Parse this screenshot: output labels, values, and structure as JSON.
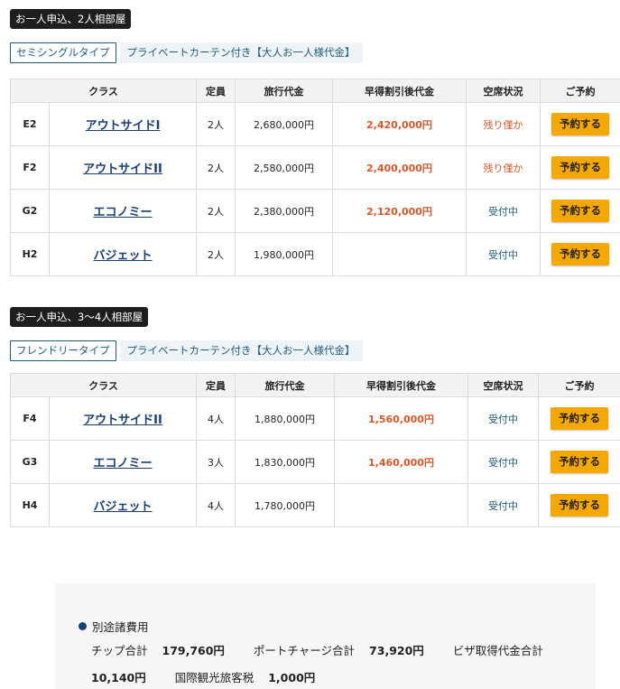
{
  "sections": [
    {
      "tag": "お一人申込、2人相部屋",
      "type_label": "セミシングルタイプ",
      "type_desc": "プライベートカーテン付き【大人お一人様代金】",
      "headers": [
        "クラス",
        "定員",
        "旅行代金",
        "早得割引後代金",
        "空席状況",
        "ご予約"
      ],
      "rows": [
        {
          "code": "E2",
          "class": "アウトサイドI",
          "capacity": "2人",
          "price": "2,680,000円",
          "discount": "2,420,000円",
          "status": "残り僅か",
          "status_type": "few",
          "button": "予約する"
        },
        {
          "code": "F2",
          "class": "アウトサイドII",
          "capacity": "2人",
          "price": "2,580,000円",
          "discount": "2,400,000円",
          "status": "残り僅か",
          "status_type": "few",
          "button": "予約する"
        },
        {
          "code": "G2",
          "class": "エコノミー",
          "capacity": "2人",
          "price": "2,380,000円",
          "discount": "2,120,000円",
          "status": "受付中",
          "status_type": "open",
          "button": "予約する"
        },
        {
          "code": "H2",
          "class": "バジェット",
          "capacity": "2人",
          "price": "1,980,000円",
          "discount": "",
          "status": "受付中",
          "status_type": "open",
          "button": "予約する"
        }
      ]
    },
    {
      "tag": "お一人申込、3〜4人相部屋",
      "type_label": "フレンドリータイプ",
      "type_desc": "プライベートカーテン付き【大人お一人様代金】",
      "headers": [
        "クラス",
        "定員",
        "旅行代金",
        "早得割引後代金",
        "空席状況",
        "ご予約"
      ],
      "rows": [
        {
          "code": "F4",
          "class": "アウトサイドII",
          "capacity": "4人",
          "price": "1,880,000円",
          "discount": "1,560,000円",
          "status": "受付中",
          "status_type": "open",
          "button": "予約する"
        },
        {
          "code": "G3",
          "class": "エコノミー",
          "capacity": "3人",
          "price": "1,830,000円",
          "discount": "1,460,000円",
          "status": "受付中",
          "status_type": "open",
          "button": "予約する"
        },
        {
          "code": "H4",
          "class": "バジェット",
          "capacity": "4人",
          "price": "1,780,000円",
          "discount": "",
          "status": "受付中",
          "status_type": "open",
          "button": "予約する"
        }
      ]
    }
  ],
  "fees": {
    "title": "別途諸費用",
    "tip_label": "チップ合計",
    "tip_value": "179,760円",
    "port_label": "ポートチャージ合計",
    "port_value": "73,920円",
    "visa_label": "ビザ取得代金合計",
    "visa_value": "10,140円",
    "tax_label": "国際観光旅客税",
    "tax_value": "1,000円"
  },
  "colors": {
    "accent_orange": "#d8572a",
    "button_yellow": "#f5a800",
    "link_navy": "#1b3f73",
    "status_teal": "#1d5c7e"
  }
}
